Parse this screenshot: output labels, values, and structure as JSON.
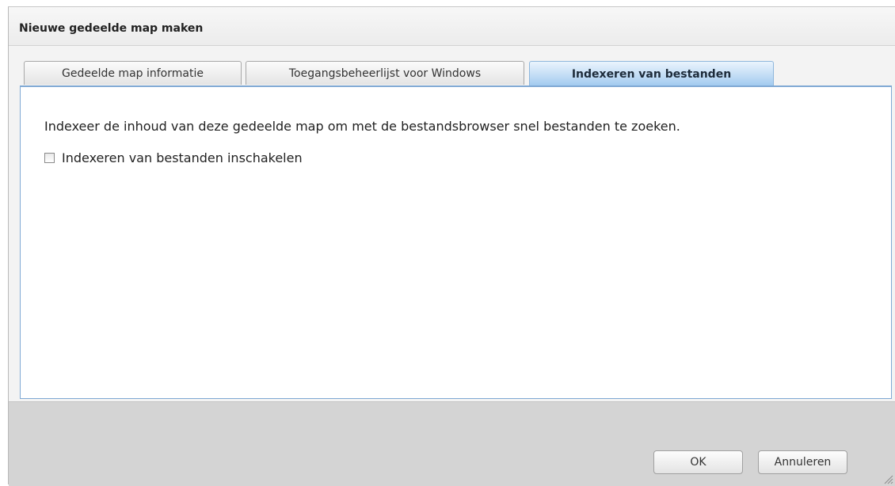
{
  "dialog": {
    "title": "Nieuwe gedeelde map maken"
  },
  "tabs": [
    {
      "label": "Gedeelde map informatie",
      "active": false
    },
    {
      "label": "Toegangsbeheerlijst voor Windows",
      "active": false
    },
    {
      "label": "Indexeren van bestanden",
      "active": true
    }
  ],
  "panel": {
    "description": "Indexeer de inhoud van deze gedeelde map om met de bestandsbrowser snel bestanden te zoeken.",
    "checkbox_label": "Indexeren van bestanden inschakelen",
    "checkbox_checked": false
  },
  "footer": {
    "ok_label": "OK",
    "cancel_label": "Annuleren"
  },
  "icons": {
    "resize": "resize-grip-icon"
  },
  "colors": {
    "active_tab": "#c3ddf5",
    "panel_border": "#7fa9d4",
    "footer_bg": "#d4d4d4"
  }
}
